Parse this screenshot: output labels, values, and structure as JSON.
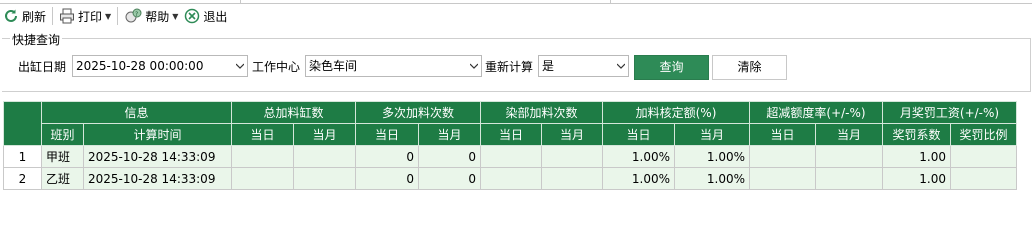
{
  "toolbar": {
    "refresh_label": "刷新",
    "print_label": "打印",
    "help_label": "帮助",
    "exit_label": "退出"
  },
  "quick_query": {
    "title": "快捷查询",
    "date_label": "出缸日期",
    "date_value": "2025-10-28 00:00:00",
    "workcenter_label": "工作中心",
    "workcenter_value": "染色车间",
    "recalc_label": "重新计算",
    "recalc_value": "是",
    "query_button": "查询",
    "clear_button": "清除"
  },
  "grid": {
    "header_top": [
      "信息",
      "总加料缸数",
      "多次加料次数",
      "染部加料次数",
      "加料核定额(%)",
      "超减额度率(+/-%)",
      "月奖罚工资(+/-%)"
    ],
    "header_sub": [
      "班别",
      "计算时间",
      "当日",
      "当月",
      "当日",
      "当月",
      "当日",
      "当月",
      "当日",
      "当月",
      "当日",
      "当月",
      "奖罚系数",
      "奖罚比例"
    ],
    "rows": [
      {
        "rn": "1",
        "shift": "甲班",
        "time": "2025-10-28 14:33:09",
        "total_day": "",
        "total_month": "",
        "multi_day": "0",
        "multi_month": "0",
        "dept_day": "",
        "dept_month": "",
        "quota_day": "1.00%",
        "quota_month": "1.00%",
        "over_day": "",
        "over_month": "",
        "coef": "1.00",
        "ratio": ""
      },
      {
        "rn": "2",
        "shift": "乙班",
        "time": "2025-10-28 14:33:09",
        "total_day": "",
        "total_month": "",
        "multi_day": "0",
        "multi_month": "0",
        "dept_day": "",
        "dept_month": "",
        "quota_day": "1.00%",
        "quota_month": "1.00%",
        "over_day": "",
        "over_month": "",
        "coef": "1.00",
        "ratio": ""
      }
    ]
  },
  "colors": {
    "header_green": "#1e7c45",
    "row_tint": "#eaf6ea",
    "query_button": "#2e8b57"
  }
}
